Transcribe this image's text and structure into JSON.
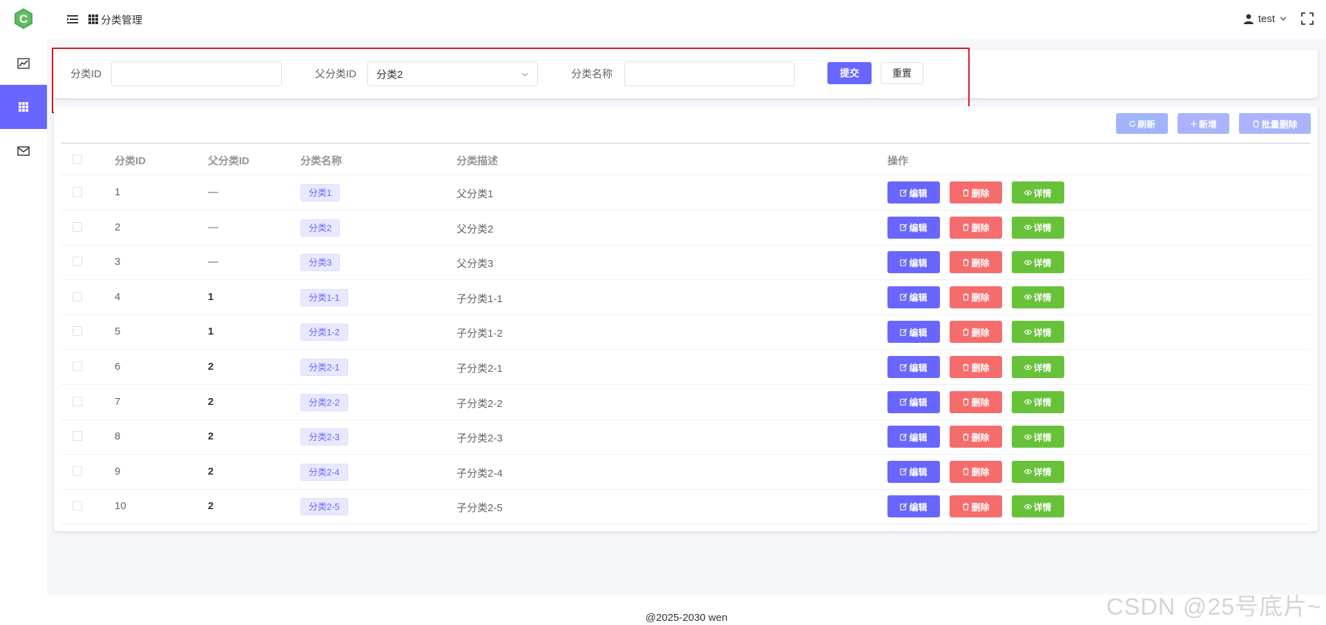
{
  "sidebar": {
    "logo_letter": "C",
    "items": [
      {
        "icon": "chart-line-icon",
        "active": false
      },
      {
        "icon": "grid-icon",
        "active": true
      },
      {
        "icon": "mail-icon",
        "active": false
      }
    ]
  },
  "header": {
    "breadcrumb": "分类管理",
    "user": "test"
  },
  "search": {
    "id_label": "分类ID",
    "id_value": "",
    "parent_label": "父分类ID",
    "parent_value": "分类2",
    "name_label": "分类名称",
    "name_value": "",
    "submit_label": "提交",
    "reset_label": "重置"
  },
  "toolbar": {
    "refresh_label": "刷新",
    "add_label": "新增",
    "batch_delete_label": "批量删除"
  },
  "table": {
    "columns": [
      "分类ID",
      "父分类ID",
      "分类名称",
      "分类描述",
      "操作"
    ],
    "actions": {
      "edit": "编辑",
      "delete": "删除",
      "detail": "详情"
    },
    "rows": [
      {
        "id": "1",
        "parent": "—",
        "name": "分类1",
        "desc": "父分类1"
      },
      {
        "id": "2",
        "parent": "—",
        "name": "分类2",
        "desc": "父分类2"
      },
      {
        "id": "3",
        "parent": "—",
        "name": "分类3",
        "desc": "父分类3"
      },
      {
        "id": "4",
        "parent": "1",
        "name": "分类1-1",
        "desc": "子分类1-1"
      },
      {
        "id": "5",
        "parent": "1",
        "name": "分类1-2",
        "desc": "子分类1-2"
      },
      {
        "id": "6",
        "parent": "2",
        "name": "分类2-1",
        "desc": "子分类2-1"
      },
      {
        "id": "7",
        "parent": "2",
        "name": "分类2-2",
        "desc": "子分类2-2"
      },
      {
        "id": "8",
        "parent": "2",
        "name": "分类2-3",
        "desc": "子分类2-3"
      },
      {
        "id": "9",
        "parent": "2",
        "name": "分类2-4",
        "desc": "子分类2-4"
      },
      {
        "id": "10",
        "parent": "2",
        "name": "分类2-5",
        "desc": "子分类2-5"
      }
    ]
  },
  "footer": {
    "text": "@2025-2030 wen",
    "watermark": "CSDN @25号底片~"
  },
  "colors": {
    "primary": "#6966ff",
    "danger": "#f56c6c",
    "success": "#67c23a",
    "highlight_border": "#e0141e"
  }
}
